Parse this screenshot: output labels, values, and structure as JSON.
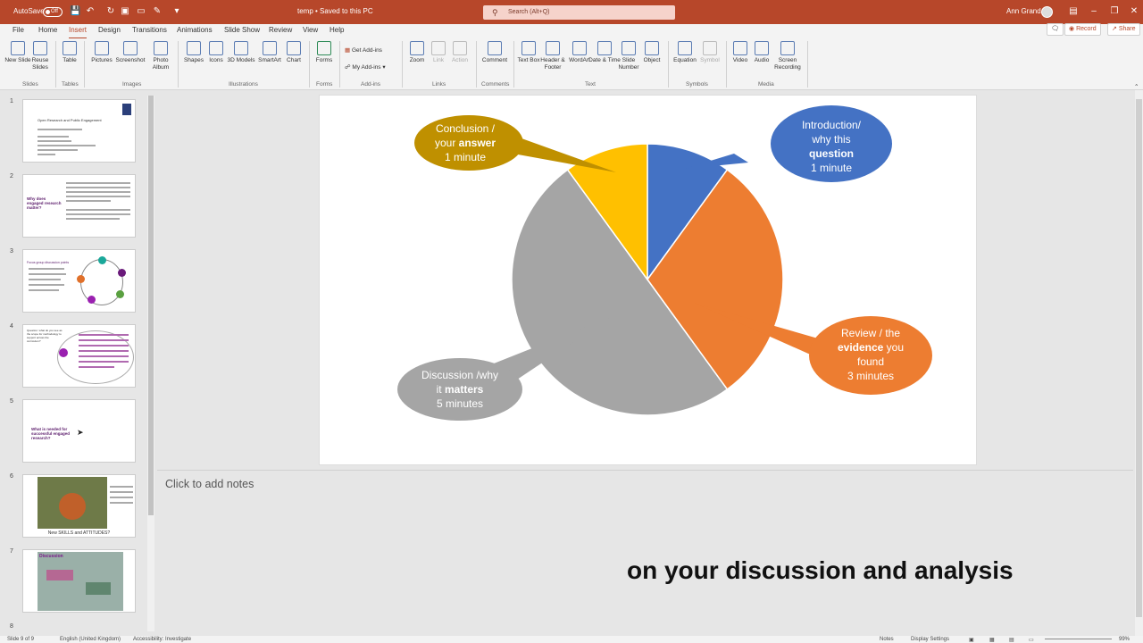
{
  "titlebar": {
    "autosave_label": "AutoSave",
    "autosave_state": "Off",
    "doc_title": "temp • Saved to this PC",
    "search_placeholder": "Search (Alt+Q)",
    "user_name": "Ann Grand"
  },
  "tabs": [
    "File",
    "Home",
    "Insert",
    "Design",
    "Transitions",
    "Animations",
    "Slide Show",
    "Review",
    "View",
    "Help"
  ],
  "active_tab": "Insert",
  "ribbon_actions": {
    "record": "Record",
    "share": "Share"
  },
  "ribbon": {
    "groups": [
      {
        "name": "Slides",
        "commands": [
          "New Slide",
          "Reuse Slides"
        ]
      },
      {
        "name": "Tables",
        "commands": [
          "Table"
        ]
      },
      {
        "name": "Images",
        "commands": [
          "Pictures",
          "Screenshot",
          "Photo Album"
        ]
      },
      {
        "name": "Illustrations",
        "commands": [
          "Shapes",
          "Icons",
          "3D Models",
          "SmartArt",
          "Chart"
        ]
      },
      {
        "name": "Forms",
        "commands": [
          "Forms"
        ]
      },
      {
        "name": "Add-ins",
        "commands": [
          "Get Add-ins",
          "My Add-ins"
        ]
      },
      {
        "name": "Links",
        "commands": [
          "Zoom",
          "Link",
          "Action"
        ]
      },
      {
        "name": "Comments",
        "commands": [
          "Comment"
        ]
      },
      {
        "name": "Text",
        "commands": [
          "Text Box",
          "Header & Footer",
          "WordArt",
          "Date & Time",
          "Slide Number",
          "Object"
        ]
      },
      {
        "name": "Symbols",
        "commands": [
          "Equation",
          "Symbol"
        ]
      },
      {
        "name": "Media",
        "commands": [
          "Video",
          "Audio",
          "Screen Recording"
        ]
      }
    ]
  },
  "thumbnails": [
    {
      "num": "1",
      "title": "Open Research and Public Engagement"
    },
    {
      "num": "2",
      "title": "Why does engaged research matter?"
    },
    {
      "num": "3",
      "title": "Focus group discussion points"
    },
    {
      "num": "4",
      "title": "Question: what do you see as the scope for methodology to support across the curriculum?"
    },
    {
      "num": "5",
      "title": "What is needed for successful engaged research?"
    },
    {
      "num": "6",
      "title": "New SKILLS and ATTITUDES?"
    },
    {
      "num": "7",
      "title": "Discussion"
    },
    {
      "num": "8",
      "title": ""
    }
  ],
  "slide_chart": {
    "chart_data": {
      "type": "pie",
      "unit": "minutes",
      "slices": [
        {
          "label": "Introduction/ why this question",
          "value": 1,
          "color": "#4472c4"
        },
        {
          "label": "Review / the evidence you found",
          "value": 3,
          "color": "#ed7d31"
        },
        {
          "label": "Discussion /why it matters",
          "value": 5,
          "color": "#a5a5a5"
        },
        {
          "label": "Conclusion / your answer",
          "value": 1,
          "color": "#ffc000"
        }
      ]
    },
    "callouts": {
      "intro": {
        "l1": "Introduction/",
        "l2": "why this",
        "l3": "question",
        "l4": "1 minute"
      },
      "review": {
        "l1": "Review / the",
        "l2": "evidence",
        "l2b": " you",
        "l3": "found",
        "l4": "3 minutes"
      },
      "discussion": {
        "l1": "Discussion /why",
        "l2a": "it ",
        "l2b": "matters",
        "l3": "5 minutes"
      },
      "conclusion": {
        "l1": "Conclusion /",
        "l2a": "your ",
        "l2b": "answer",
        "l3": "1 minute"
      }
    }
  },
  "notes_placeholder": "Click to add notes",
  "caption": "on your discussion and analysis",
  "statusbar": {
    "slide_count": "Slide 9 of 9",
    "language": "English (United Kingdom)",
    "accessibility": "Accessibility: Investigate",
    "notes": "Notes",
    "display_settings": "Display Settings",
    "zoom": "99%"
  },
  "colors": {
    "brand": "#b7472a"
  }
}
